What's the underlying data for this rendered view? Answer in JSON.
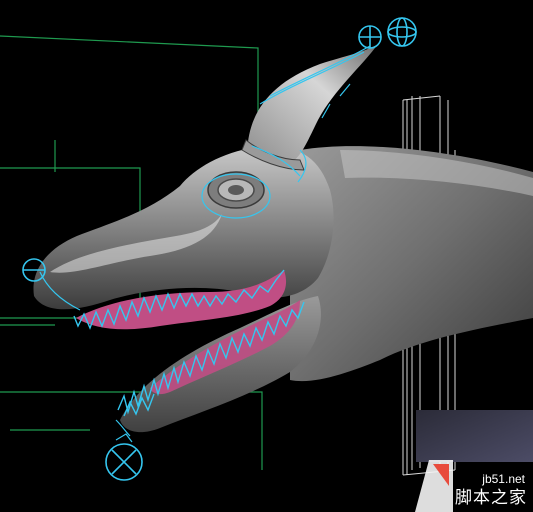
{
  "viewport": {
    "background": "#000000",
    "grid_color": "#1f9a4f",
    "cage_color": "#d8d8d8",
    "rig_color": "#35c6ef",
    "gum_color": "#c04e84"
  },
  "watermark": {
    "url": "jb51.net",
    "name": "脚本之家",
    "icon": "document-icon"
  }
}
